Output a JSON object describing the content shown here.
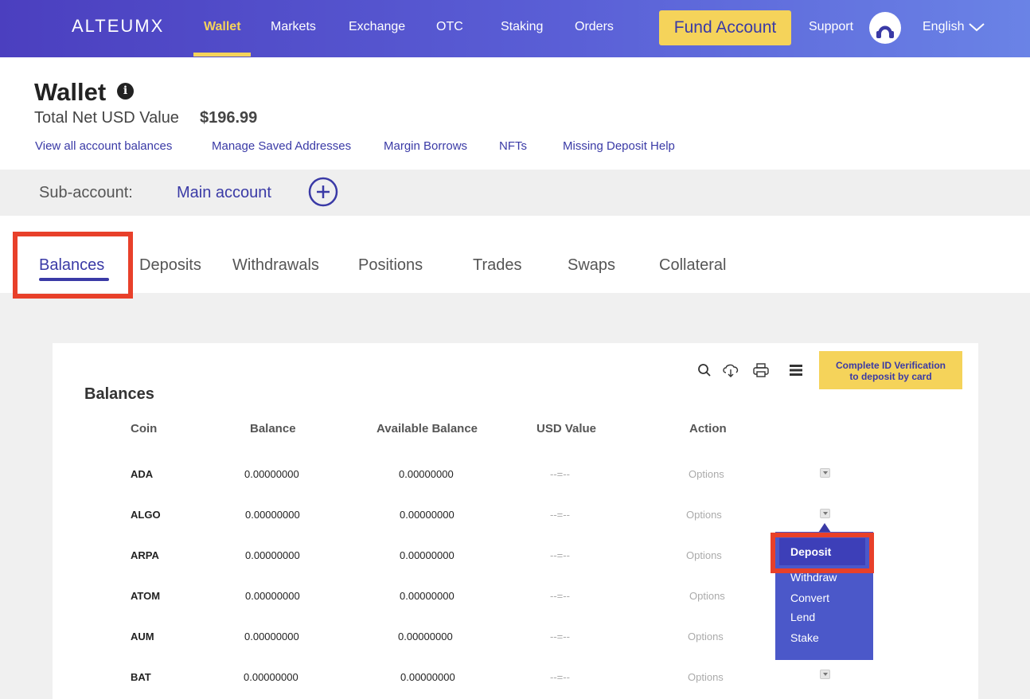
{
  "nav": {
    "logo": "ALTEUMX",
    "items": [
      {
        "label": "Wallet",
        "active": true
      },
      {
        "label": "Markets"
      },
      {
        "label": "Exchange"
      },
      {
        "label": "OTC"
      },
      {
        "label": "Staking"
      },
      {
        "label": "Orders"
      }
    ],
    "fund_button": "Fund Account",
    "support": "Support",
    "language": "English"
  },
  "header": {
    "title": "Wallet",
    "net_label": "Total Net USD Value",
    "net_value": "$196.99",
    "links": [
      "View all account balances",
      "Manage Saved Addresses",
      "Margin Borrows",
      "NFTs",
      "Missing Deposit Help"
    ]
  },
  "subaccount": {
    "label": "Sub-account:",
    "value": "Main account"
  },
  "tabs": [
    "Balances",
    "Deposits",
    "Withdrawals",
    "Positions",
    "Trades",
    "Swaps",
    "Collateral"
  ],
  "balances": {
    "title": "Balances",
    "verify_button_line1": "Complete ID Verification",
    "verify_button_line2": "to deposit by card",
    "columns": [
      "Coin",
      "Balance",
      "Available Balance",
      "USD Value",
      "Action"
    ],
    "rows": [
      {
        "coin": "ADA",
        "balance": "0.00000000",
        "available": "0.00000000",
        "usd": "--=--",
        "action": "Options"
      },
      {
        "coin": "ALGO",
        "balance": "0.00000000",
        "available": "0.00000000",
        "usd": "--=--",
        "action": "Options"
      },
      {
        "coin": "ARPA",
        "balance": "0.00000000",
        "available": "0.00000000",
        "usd": "--=--",
        "action": "Options"
      },
      {
        "coin": "ATOM",
        "balance": "0.00000000",
        "available": "0.00000000",
        "usd": "--=--",
        "action": "Options"
      },
      {
        "coin": "AUM",
        "balance": "0.00000000",
        "available": "0.00000000",
        "usd": "--=--",
        "action": "Options"
      },
      {
        "coin": "BAT",
        "balance": "0.00000000",
        "available": "0.00000000",
        "usd": "--=--",
        "action": "Options"
      }
    ]
  },
  "action_menu": [
    "Deposit",
    "Withdraw",
    "Convert",
    "Lend",
    "Stake"
  ],
  "colors": {
    "brand": "#4b3fbf",
    "accent": "#f5d35a",
    "highlight": "#e8402a",
    "menu": "#4b58c9"
  },
  "icons": [
    "info-icon",
    "avatar-icon",
    "chevron-down-icon",
    "plus-circle-icon",
    "search-icon",
    "cloud-download-icon",
    "print-icon",
    "menu-icon",
    "caret-down-icon"
  ]
}
